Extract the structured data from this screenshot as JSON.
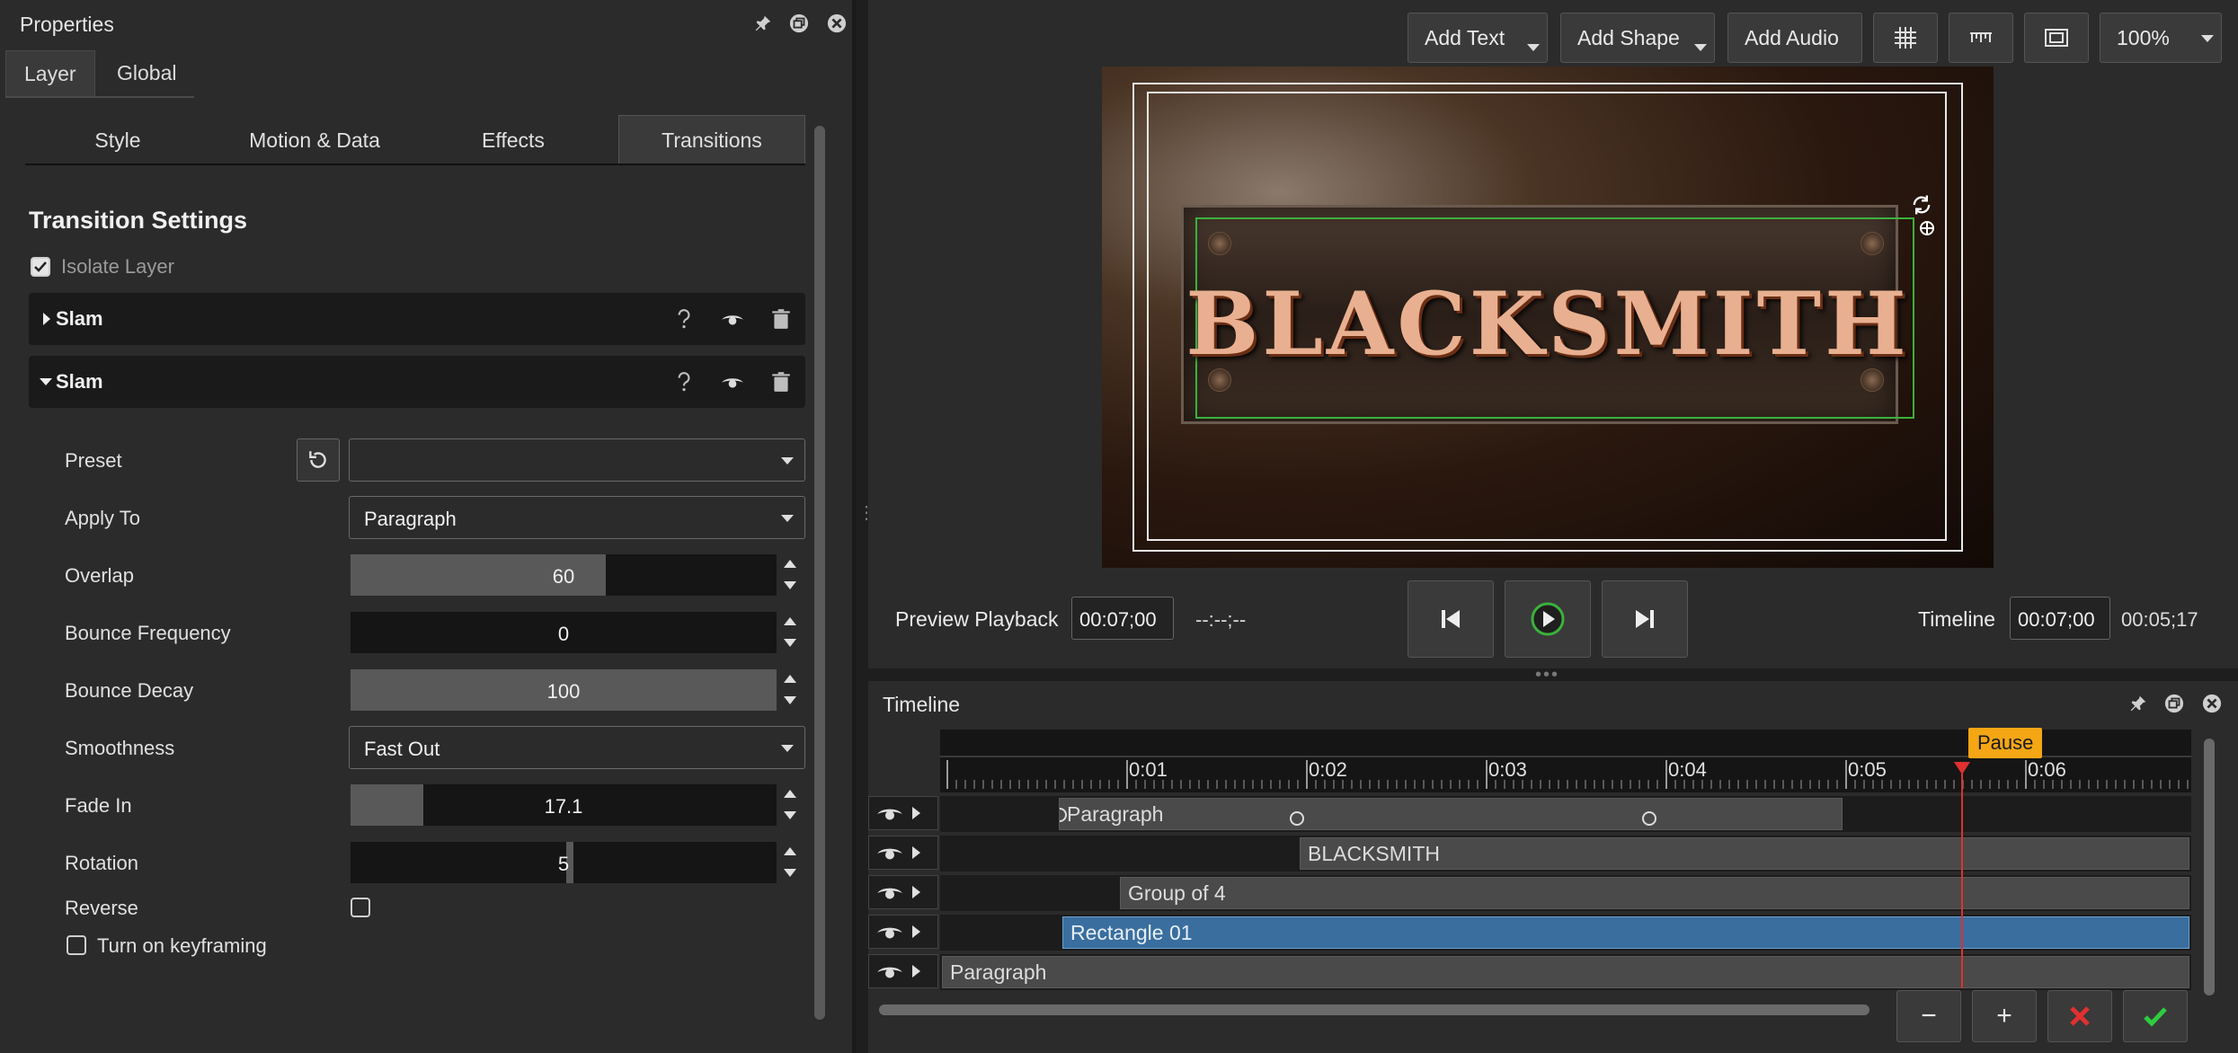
{
  "properties": {
    "title": "Properties",
    "tabs": [
      "Layer",
      "Global"
    ],
    "subtabs": [
      "Style",
      "Motion & Data",
      "Effects",
      "Transitions"
    ],
    "section_title": "Transition Settings",
    "isolate_layer": {
      "label": "Isolate Layer",
      "checked": true
    },
    "transitions": [
      {
        "name": "Slam",
        "expanded": false
      },
      {
        "name": "Slam",
        "expanded": true
      }
    ],
    "fields": {
      "preset": {
        "label": "Preset",
        "value": ""
      },
      "apply_to": {
        "label": "Apply To",
        "value": "Paragraph"
      },
      "overlap": {
        "label": "Overlap",
        "value": "60",
        "fill_fraction": 0.6
      },
      "bounce_frequency": {
        "label": "Bounce Frequency",
        "value": "0",
        "fill_fraction": 0.0
      },
      "bounce_decay": {
        "label": "Bounce Decay",
        "value": "100",
        "fill_fraction": 1.0
      },
      "smoothness": {
        "label": "Smoothness",
        "value": "Fast Out"
      },
      "fade_in": {
        "label": "Fade In",
        "value": "17.1",
        "fill_fraction": 0.171
      },
      "rotation": {
        "label": "Rotation",
        "value": "5"
      },
      "reverse": {
        "label": "Reverse",
        "checked": false
      },
      "keyframing": {
        "label": "Turn on keyframing",
        "checked": false
      }
    }
  },
  "toolbar": {
    "add_text": "Add Text",
    "add_shape": "Add Shape",
    "add_audio": "Add Audio",
    "zoom": "100%"
  },
  "preview": {
    "title_text": "BLACKSMITH",
    "playback_label": "Preview Playback",
    "playback_time": "00:07;00",
    "playback_placeholder": "--:--;--",
    "timeline_label": "Timeline",
    "timeline_time": "00:07;00",
    "current_time": "00:05;17"
  },
  "timeline": {
    "title": "Timeline",
    "ticks": [
      "0:01",
      "0:02",
      "0:03",
      "0:04",
      "0:05",
      "0:06"
    ],
    "playhead_label": "Pause",
    "tracks": [
      {
        "name": "Paragraph",
        "selected": false
      },
      {
        "name": "BLACKSMITH",
        "selected": false
      },
      {
        "name": "Group of 4",
        "selected": false
      },
      {
        "name": "Rectangle 01",
        "selected": true
      },
      {
        "name": "Paragraph",
        "selected": false
      }
    ],
    "zoom_out": "−",
    "zoom_in": "+"
  },
  "colors": {
    "accent_selected_clip": "#3a6e9e",
    "playhead": "#e03030",
    "pause_tag": "#f4a614",
    "confirm": "#2ecc40",
    "cancel": "#e03030"
  },
  "icons": [
    "pin-icon",
    "float-icon",
    "close-icon",
    "help-icon",
    "eye-icon",
    "trash-icon",
    "reset-icon",
    "grid-icon",
    "ruler-icon",
    "safe-area-icon",
    "skip-back-icon",
    "play-icon",
    "skip-forward-icon",
    "cancel-icon",
    "confirm-icon"
  ]
}
